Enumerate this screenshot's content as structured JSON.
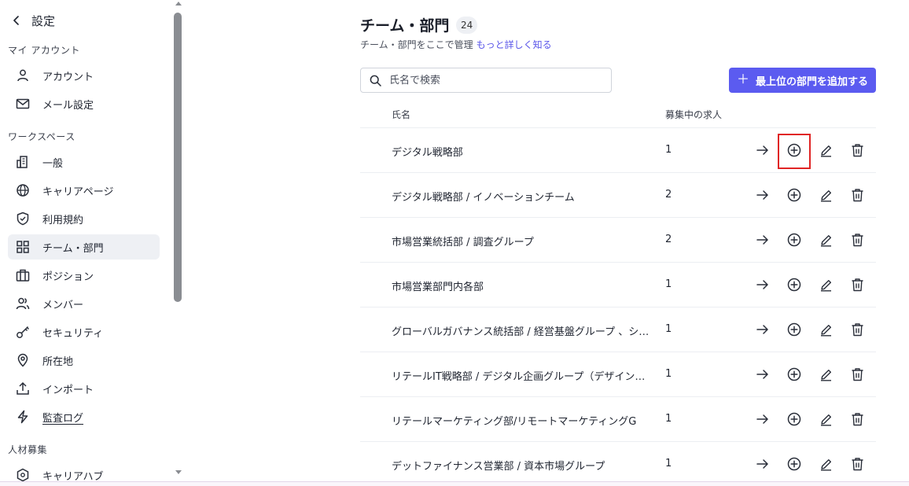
{
  "sidebar": {
    "back_title": "設定",
    "sections": [
      {
        "label": "マイ アカウント",
        "items": [
          {
            "label": "アカウント",
            "icon": "user-icon"
          },
          {
            "label": "メール設定",
            "icon": "mail-icon"
          }
        ]
      },
      {
        "label": "ワークスペース",
        "items": [
          {
            "label": "一般",
            "icon": "building-icon"
          },
          {
            "label": "キャリアページ",
            "icon": "globe-icon"
          },
          {
            "label": "利用規約",
            "icon": "shield-check-icon"
          },
          {
            "label": "チーム・部門",
            "icon": "grid-icon",
            "active": true
          },
          {
            "label": "ポジション",
            "icon": "briefcase-icon"
          },
          {
            "label": "メンバー",
            "icon": "users-icon"
          },
          {
            "label": "セキュリティ",
            "icon": "key-icon"
          },
          {
            "label": "所在地",
            "icon": "map-pin-icon"
          },
          {
            "label": "インポート",
            "icon": "upload-icon"
          },
          {
            "label": "監査ログ",
            "icon": "bolt-icon"
          }
        ]
      },
      {
        "label": "人材募集",
        "items": [
          {
            "label": "キャリアハブ",
            "icon": "hub-icon"
          }
        ]
      }
    ]
  },
  "main": {
    "title": "チーム・部門",
    "count": "24",
    "subtitle": "チーム・部門をここで管理",
    "learn_more": "もっと詳しく知る",
    "search_placeholder": "氏名で検索",
    "add_button": "最上位の部門を追加する",
    "columns": {
      "name": "氏名",
      "jobs": "募集中の求人"
    },
    "rows": [
      {
        "name": "デジタル戦略部",
        "jobs": "1"
      },
      {
        "name": "デジタル戦略部 / イノベーションチーム",
        "jobs": "2"
      },
      {
        "name": "市場営業統括部 / 調査グループ",
        "jobs": "2"
      },
      {
        "name": "市場営業部門内各部",
        "jobs": "1"
      },
      {
        "name": "グローバルガバナンス統括部 / 経営基盤グループ 、シ…",
        "jobs": "1"
      },
      {
        "name": "リテールIT戦略部 / デジタル企画グループ（デザイン…",
        "jobs": "1"
      },
      {
        "name": "リテールマーケティング部/リモートマーケティングG",
        "jobs": "1"
      },
      {
        "name": "デットファイナンス営業部 / 資本市場グループ",
        "jobs": "1"
      }
    ]
  },
  "colors": {
    "accent": "#5b5bf0",
    "link": "#5a56e9",
    "highlight": "#e02424",
    "active_bg": "#eef0f4"
  }
}
